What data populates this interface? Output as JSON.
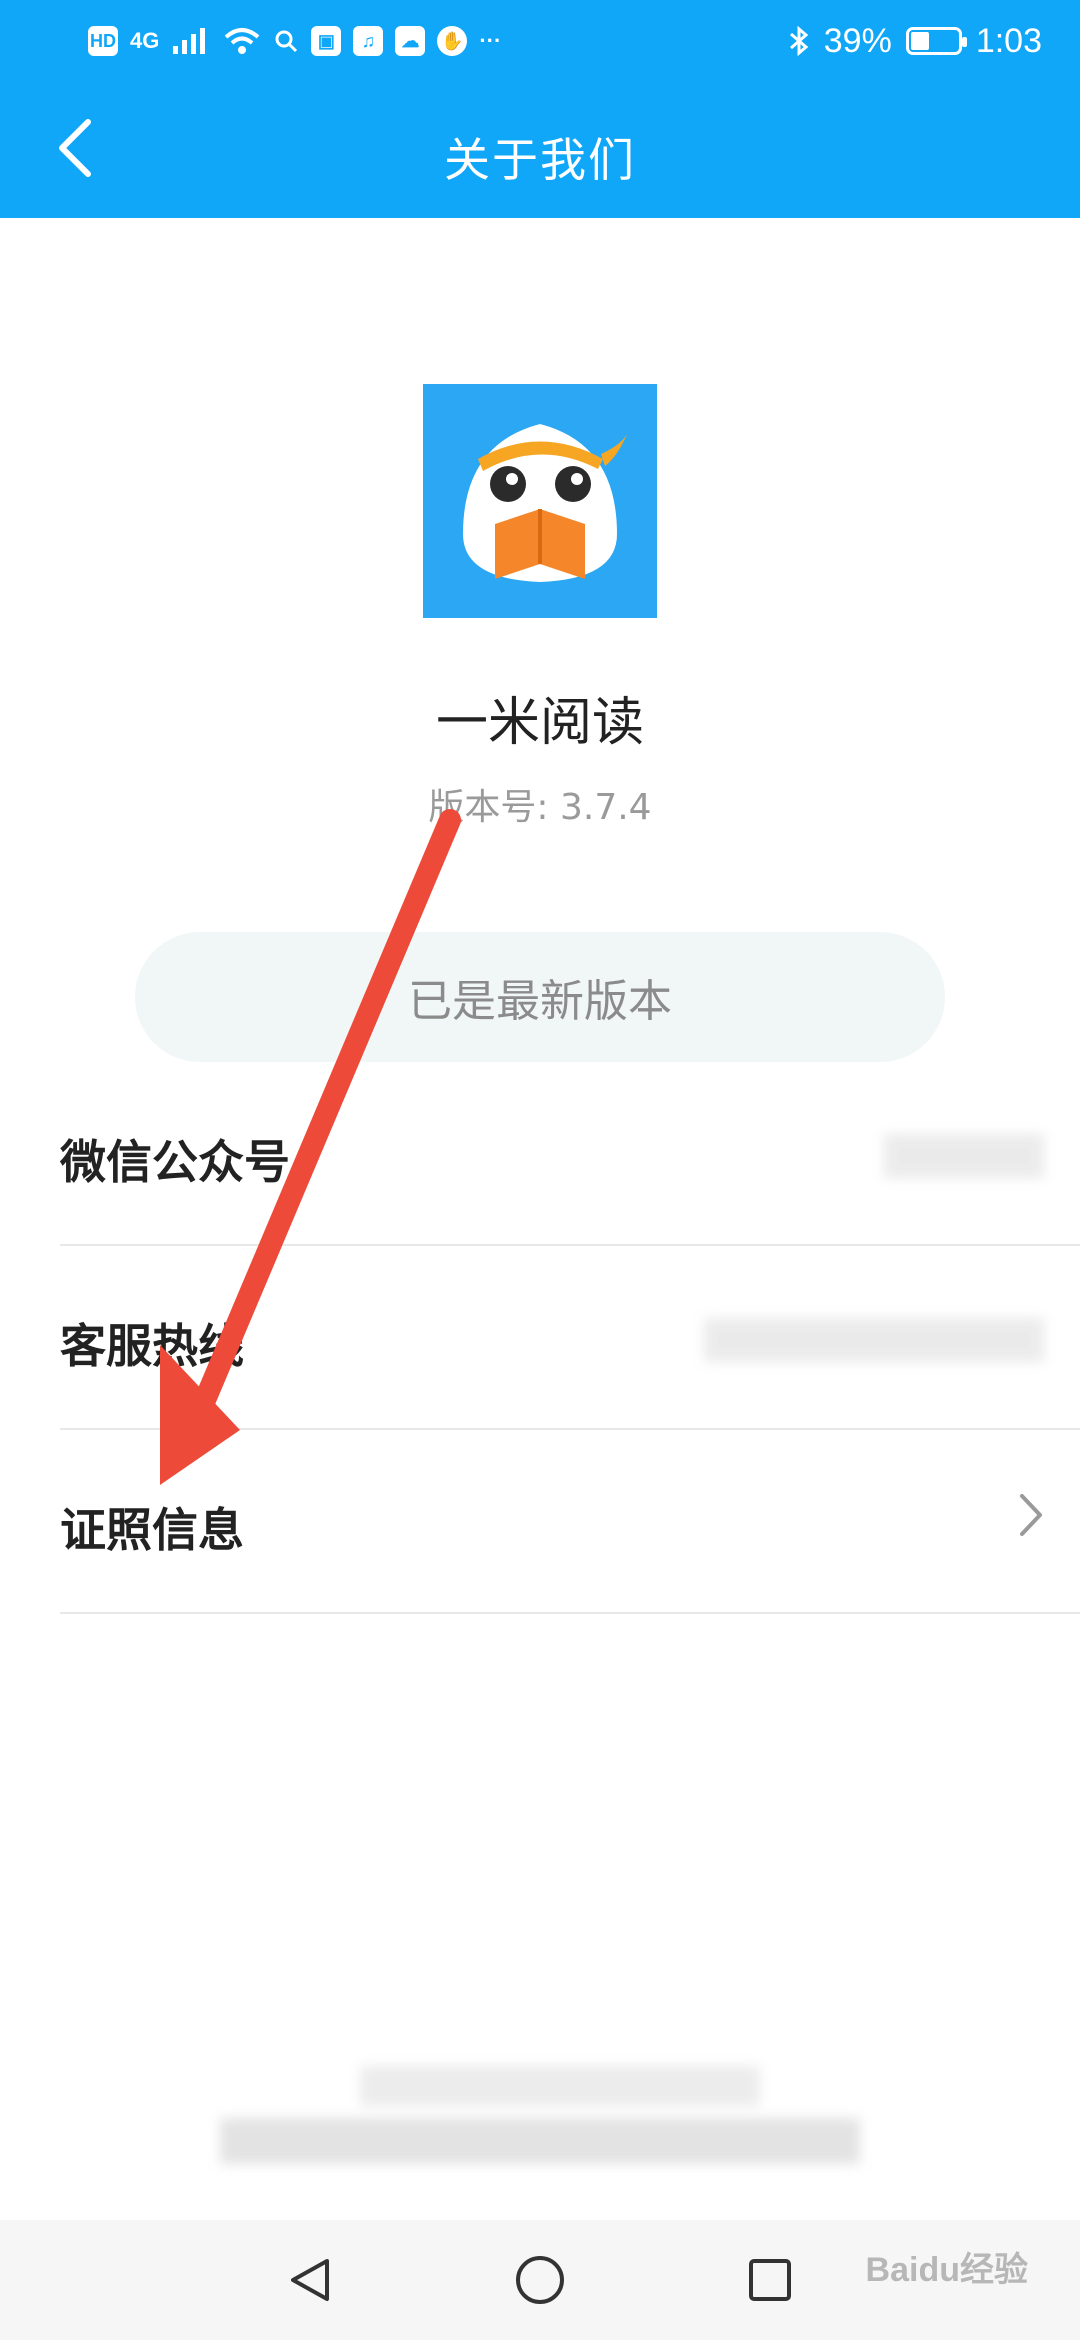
{
  "status_bar": {
    "hd_label": "HD",
    "network_label": "4G",
    "battery_percent": "39%",
    "battery_level": 0.39,
    "time": "1:03",
    "more_label": "···"
  },
  "header": {
    "title": "关于我们"
  },
  "app": {
    "name": "一米阅读",
    "version": "版本号: 3.7.4",
    "icon_bg": "#2ca7f3"
  },
  "update_button": {
    "label": "已是最新版本"
  },
  "rows": [
    {
      "label": "微信公众号"
    },
    {
      "label": "客服热线"
    },
    {
      "label": "证照信息"
    }
  ],
  "watermark": "Baidu经验",
  "colors": {
    "accent": "#11a7f8",
    "annotation_arrow": "#ee4a3a"
  }
}
